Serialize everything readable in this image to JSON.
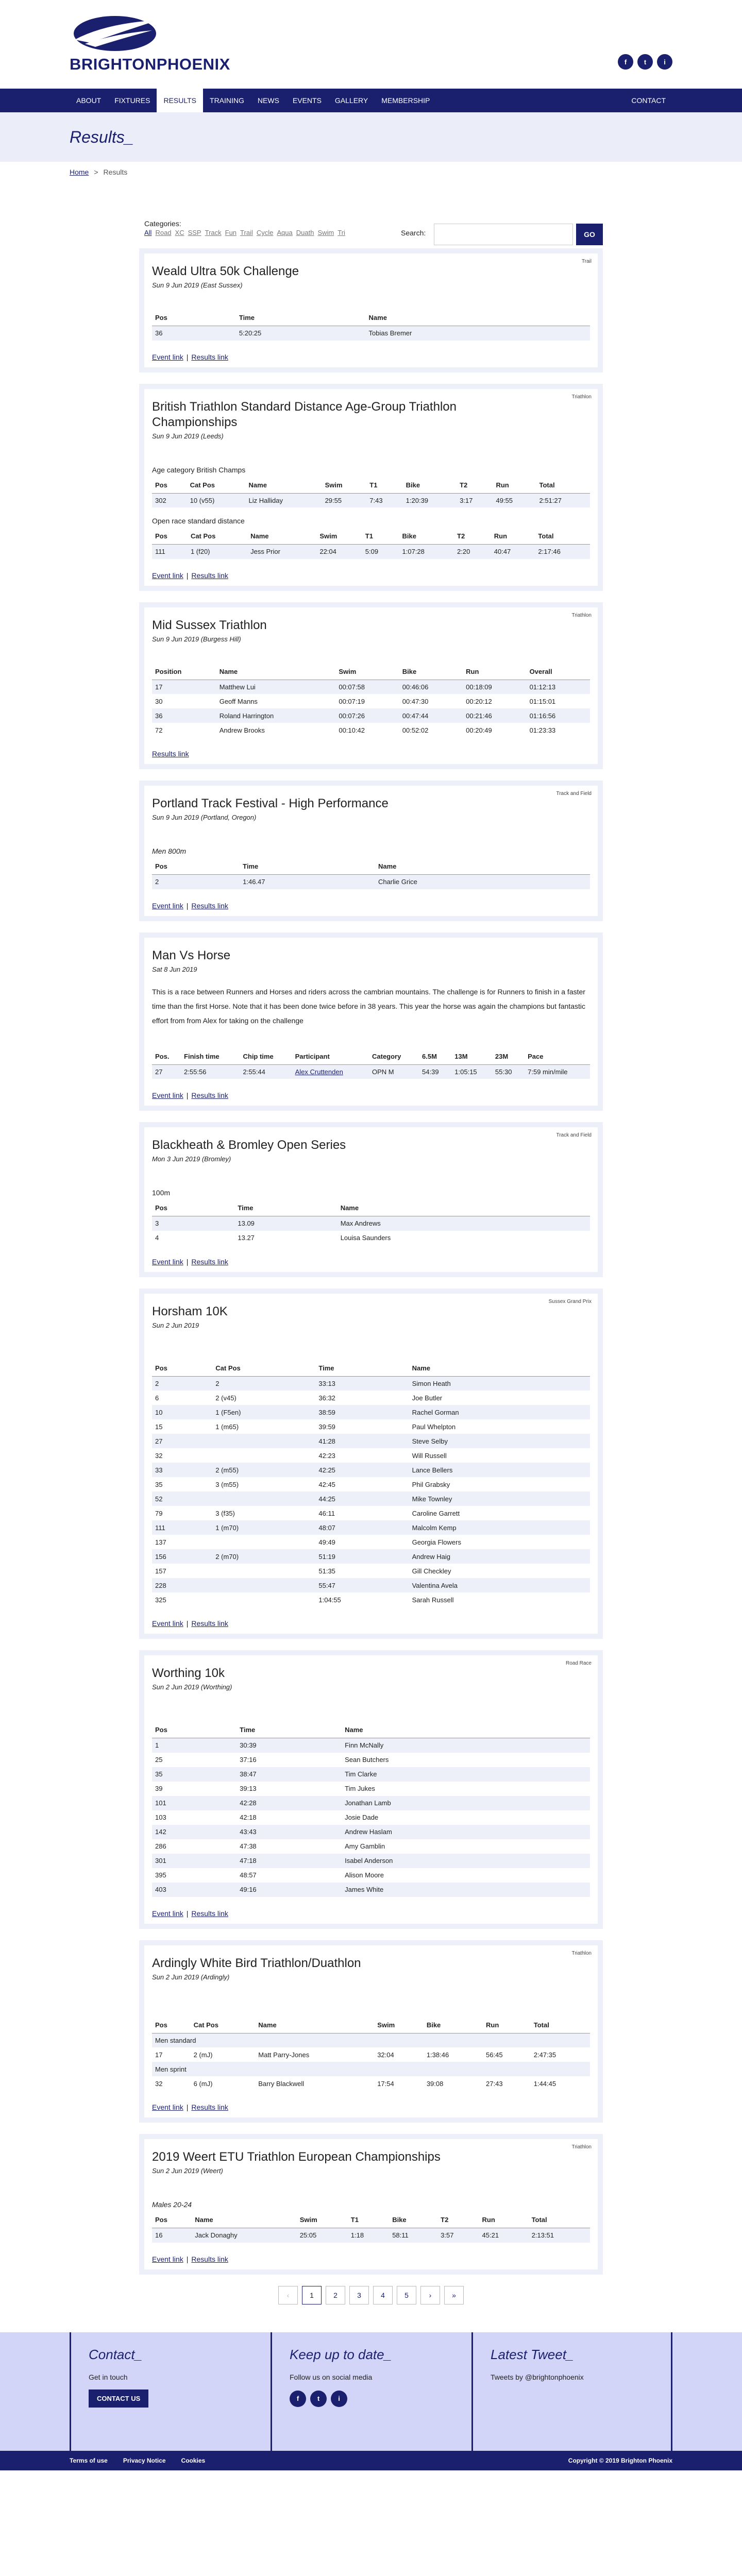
{
  "site": {
    "name": "BRIGHTONPHOENIX"
  },
  "social": [
    "f",
    "t",
    "i"
  ],
  "nav": {
    "items": [
      "ABOUT",
      "FIXTURES",
      "RESULTS",
      "TRAINING",
      "NEWS",
      "EVENTS",
      "GALLERY",
      "MEMBERSHIP"
    ],
    "contact": "CONTACT"
  },
  "banner": {
    "title": "Results_"
  },
  "crumbs": {
    "home": "Home",
    "sep": ">",
    "current": "Results"
  },
  "filters": {
    "categories_label": "Categories:",
    "categories": [
      "All",
      "Road",
      "XC",
      "SSP",
      "Track",
      "Fun",
      "Trail",
      "Cycle",
      "Aqua",
      "Duath",
      "Swim",
      "Tri"
    ],
    "search_label": "Search:",
    "go": "GO"
  },
  "links": {
    "event": "Event link",
    "results": "Results link",
    "sep": "|"
  },
  "events": {
    "e1": {
      "title": "Weald Ultra 50k Challenge",
      "date": "Sun 9 Jun 2019 (East Sussex)",
      "badge": "Trail",
      "headers": [
        "Pos",
        "Time",
        "Name"
      ],
      "rows": [
        [
          "36",
          "5:20:25",
          "Tobias Bremer"
        ]
      ]
    },
    "e2": {
      "title": "British Triathlon Standard Distance Age-Group Triathlon Championships",
      "date": "Sun 9 Jun 2019 (Leeds)",
      "badge": "Triathlon",
      "sub1": "Age category British Champs",
      "sub2": "Open race standard distance",
      "headers": [
        "Pos",
        "Cat Pos",
        "Name",
        "Swim",
        "T1",
        "Bike",
        "T2",
        "Run",
        "Total"
      ],
      "rows1": [
        [
          "302",
          "10 (v55)",
          "Liz Halliday",
          "29:55",
          "7:43",
          "1:20:39",
          "3:17",
          "49:55",
          "2:51:27"
        ]
      ],
      "rows2": [
        [
          "111",
          "1 (f20)",
          "Jess Prior",
          "22:04",
          "5:09",
          "1:07:28",
          "2:20",
          "40:47",
          "2:17:46"
        ]
      ]
    },
    "e3": {
      "title": "Mid Sussex Triathlon",
      "date": "Sun 9 Jun 2019 (Burgess Hill)",
      "badge": "Triathlon",
      "headers": [
        "Position",
        "Name",
        "Swim",
        "Bike",
        "Run",
        "Overall"
      ],
      "rows": [
        [
          "17",
          "Matthew Lui",
          "00:07:58",
          "00:46:06",
          "00:18:09",
          "01:12:13"
        ],
        [
          "30",
          "Geoff Manns",
          "00:07:19",
          "00:47:30",
          "00:20:12",
          "01:15:01"
        ],
        [
          "36",
          "Roland Harrington",
          "00:07:26",
          "00:47:44",
          "00:21:46",
          "01:16:56"
        ],
        [
          "72",
          "Andrew Brooks",
          "00:10:42",
          "00:52:02",
          "00:20:49",
          "01:23:33"
        ]
      ]
    },
    "e4": {
      "title": "Portland Track Festival - High Performance",
      "date": "Sun 9 Jun 2019 (Portland, Oregon)",
      "badge": "Track and Field",
      "sub": "Men 800m",
      "headers": [
        "Pos",
        "Time",
        "Name"
      ],
      "rows": [
        [
          "2",
          "1:46.47",
          "Charlie Grice"
        ]
      ]
    },
    "e5": {
      "title": "Man Vs Horse",
      "date": "Sat 8 Jun 2019",
      "desc": "This is a race between Runners and Horses and riders across the cambrian mountains. The challenge is for Runners to finish in a faster time than the first Horse. Note that it has been done twice before in 38 years. This year the horse was again the champions but fantastic effort from from Alex for taking on the challenge",
      "headers": [
        "Pos.",
        "Finish time",
        "Chip time",
        "Participant",
        "Category",
        "6.5M",
        "13M",
        "23M",
        "Pace"
      ],
      "rows": [
        [
          "27",
          "2:55:56",
          "2:55:44",
          "Alex Cruttenden",
          "OPN M",
          "54:39",
          "1:05:15",
          "55:30",
          "7:59 min/mile"
        ]
      ]
    },
    "e6": {
      "title": "Blackheath & Bromley Open Series",
      "date": "Mon 3 Jun 2019 (Bromley)",
      "badge": "Track and Field",
      "sub": "100m",
      "headers": [
        "Pos",
        "Time",
        "Name"
      ],
      "rows": [
        [
          "3",
          "13.09",
          "Max Andrews"
        ],
        [
          "4",
          "13.27",
          "Louisa Saunders"
        ]
      ]
    },
    "e7": {
      "title": "Horsham 10K",
      "date": "Sun 2 Jun 2019",
      "badge": "Sussex Grand Prix",
      "headers": [
        "Pos",
        "Cat Pos",
        "Time",
        "Name"
      ],
      "rows": [
        [
          "2",
          "2",
          "33:13",
          "Simon Heath"
        ],
        [
          "6",
          "2 (v45)",
          "36:32",
          "Joe Butler"
        ],
        [
          "10",
          "1 (F5en)",
          "38:59",
          "Rachel Gorman"
        ],
        [
          "15",
          "1 (m65)",
          "39:59",
          "Paul Whelpton"
        ],
        [
          "27",
          "",
          "41:28",
          "Steve Selby"
        ],
        [
          "32",
          "",
          "42:23",
          "Will Russell"
        ],
        [
          "33",
          "2 (m55)",
          "42:25",
          "Lance Bellers"
        ],
        [
          "35",
          "3 (m55)",
          "42:45",
          "Phil Grabsky"
        ],
        [
          "52",
          "",
          "44:25",
          "Mike Townley"
        ],
        [
          "79",
          "3 (f35)",
          "46:11",
          "Caroline Garrett"
        ],
        [
          "111",
          "1 (m70)",
          "48:07",
          "Malcolm Kemp"
        ],
        [
          "137",
          "",
          "49:49",
          "Georgia Flowers"
        ],
        [
          "156",
          "2 (m70)",
          "51:19",
          "Andrew Haig"
        ],
        [
          "157",
          "",
          "51:35",
          "Gill Checkley"
        ],
        [
          "228",
          "",
          "55:47",
          "Valentina Avela"
        ],
        [
          "325",
          "",
          "1:04:55",
          "Sarah Russell"
        ]
      ]
    },
    "e8": {
      "title": "Worthing 10k",
      "date": "Sun 2 Jun 2019 (Worthing)",
      "badge": "Road Race",
      "headers": [
        "Pos",
        "Time",
        "Name"
      ],
      "rows": [
        [
          "1",
          "30:39",
          "Finn McNally"
        ],
        [
          "25",
          "37:16",
          "Sean Butchers"
        ],
        [
          "35",
          "38:47",
          "Tim Clarke"
        ],
        [
          "39",
          "39:13",
          "Tim Jukes"
        ],
        [
          "101",
          "42:28",
          "Jonathan Lamb"
        ],
        [
          "103",
          "42:18",
          "Josie Dade"
        ],
        [
          "142",
          "43:43",
          "Andrew Haslam"
        ],
        [
          "286",
          "47:38",
          "Amy Gamblin"
        ],
        [
          "301",
          "47:18",
          "Isabel Anderson"
        ],
        [
          "395",
          "48:57",
          "Alison Moore"
        ],
        [
          "403",
          "49:16",
          "James White"
        ]
      ]
    },
    "e9": {
      "title": "Ardingly White Bird Triathlon/Duathlon",
      "date": "Sun 2 Jun 2019 (Ardingly)",
      "badge": "Triathlon",
      "headers": [
        "Pos",
        "Cat Pos",
        "Name",
        "Swim",
        "Bike",
        "Run",
        "Total"
      ],
      "grp1": "Men standard",
      "grp2": "Men sprint",
      "rows1": [
        [
          "17",
          "2 (mJ)",
          "Matt Parry-Jones",
          "32:04",
          "1:38:46",
          "56:45",
          "2:47:35"
        ]
      ],
      "rows2": [
        [
          "32",
          "6 (mJ)",
          "Barry Blackwell",
          "17:54",
          "39:08",
          "27:43",
          "1:44:45"
        ]
      ]
    },
    "e10": {
      "title": "2019 Weert ETU Triathlon European Championships",
      "date": "Sun 2 Jun 2019 (Weert)",
      "badge": "Triathlon",
      "sub": "Males 20-24",
      "headers": [
        "Pos",
        "Name",
        "Swim",
        "T1",
        "Bike",
        "T2",
        "Run",
        "Total"
      ],
      "rows": [
        [
          "16",
          "Jack Donaghy",
          "25:05",
          "1:18",
          "58:11",
          "3:57",
          "45:21",
          "2:13:51"
        ]
      ]
    }
  },
  "pager": [
    "‹",
    "1",
    "2",
    "3",
    "4",
    "5",
    "›",
    "»"
  ],
  "footer": {
    "contact_title": "Contact_",
    "contact_text": "Get in touch",
    "contact_btn": "CONTACT US",
    "keep_title": "Keep up to date_",
    "keep_text": "Follow us on social media",
    "tweet_title": "Latest Tweet_",
    "tweet_text": "Tweets by @brightonphoenix",
    "bar_links": [
      "Terms of use",
      "Privacy Notice",
      "Cookies"
    ],
    "copyright": "Copyright © 2019 Brighton Phoenix"
  },
  "colors": {
    "navy": "#1a1f6e",
    "light": "#eef0f9",
    "footer": "#d2d5f7"
  }
}
